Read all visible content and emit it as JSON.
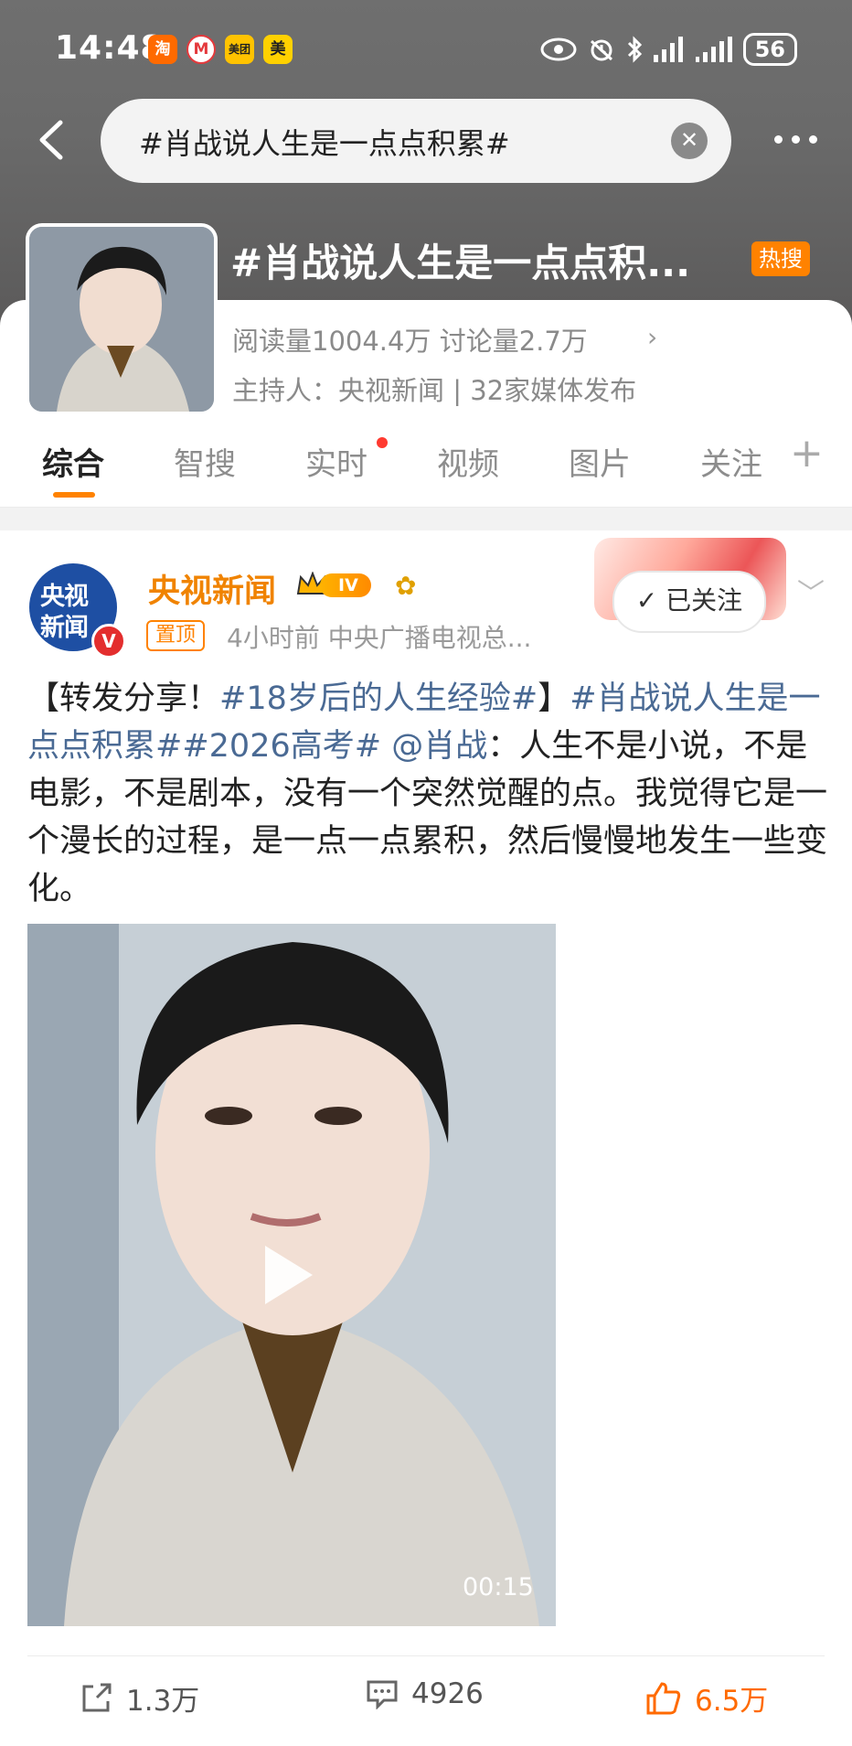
{
  "status_bar": {
    "time": "14:48",
    "apps": [
      "淘",
      "M",
      "美团",
      "美"
    ],
    "battery": "56"
  },
  "search": {
    "query": "#肖战说人生是一点点积累#"
  },
  "topic": {
    "title": "#肖战说人生是一点点积...",
    "hot_badge": "热搜",
    "stats": "阅读量1004.4万  讨论量2.7万",
    "host": "主持人：央视新闻 | 32家媒体发布"
  },
  "tabs": [
    "综合",
    "智搜",
    "实时",
    "视频",
    "图片",
    "关注"
  ],
  "post": {
    "avatar_line1": "央视",
    "avatar_line2": "新闻",
    "author": "央视新闻",
    "level": "IV",
    "pinned": "置顶",
    "meta": "4小时前  中央广播电视总...",
    "follow_label": "已关注",
    "text_prefix": "【转发分享！",
    "tag1": "#18岁后的人生经验#",
    "text_mid": "】",
    "tag2": "#肖战说人生是一点点积累#",
    "tag3": "#2026高考#",
    "mention": " @肖战",
    "text_body": "：人生不是小说，不是电影，不是剧本，没有一个突然觉醒的点。我觉得它是一个漫长的过程，是一点一点累积，然后慢慢地发生一些变化。",
    "video_duration": "00:15",
    "reposts": "1.3万",
    "comments": "4926",
    "likes": "6.5万"
  }
}
